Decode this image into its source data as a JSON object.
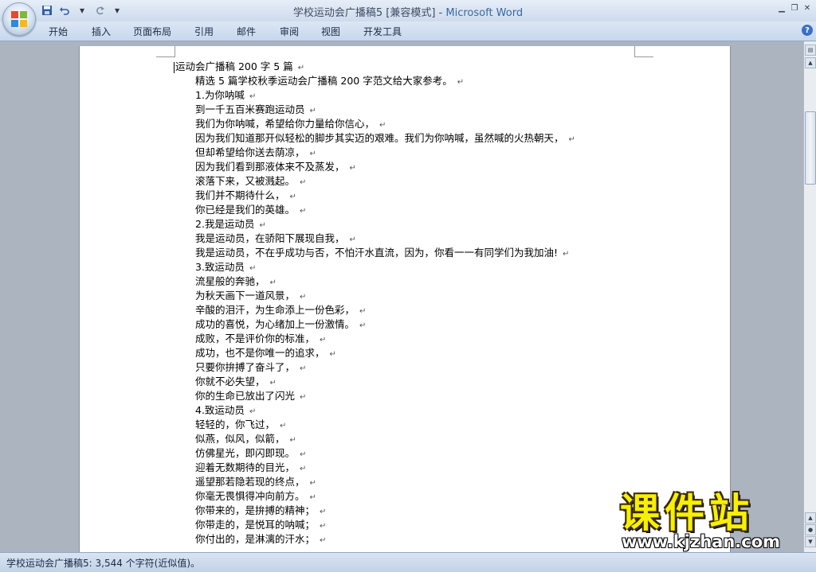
{
  "window": {
    "title": "学校运动会广播稿5 [兼容模式] - ",
    "app_name": "Microsoft Word"
  },
  "ribbon": {
    "tabs": [
      "开始",
      "插入",
      "页面布局",
      "引用",
      "邮件",
      "审阅",
      "视图",
      "开发工具"
    ]
  },
  "document": {
    "lines": [
      "运动会广播稿 200 字 5 篇",
      "精选 5 篇学校秋季运动会广播稿 200 字范文给大家参考。",
      "1.为你呐喊",
      "到一千五百米赛跑运动员",
      "我们为你呐喊，希望给你力量给你信心，",
      "因为我们知道那开似轻松的脚步其实迈的艰难。我们为你呐喊，虽然喊的火热朝天，",
      "但却希望给你送去荫凉，",
      "因为我们看到那液体来不及蒸发，",
      "滚落下来，又被溅起。",
      "我们并不期待什么，",
      "你已经是我们的英雄。",
      "2.我是运动员",
      "我是运动员，在骄阳下展现自我，",
      "我是运动员，不在乎成功与否，不怕汗水直流，因为，你看一一有同学们为我加油!",
      "3.致运动员",
      "流星般的奔驰，",
      "为秋天画下一道风景，",
      "辛酸的泪汗，为生命添上一份色彩，",
      "成功的喜悦，为心绪加上一份激情。",
      "成败，不是评价你的标准，",
      "成功，也不是你唯一的追求，",
      "只要你拚搏了奋斗了，",
      "你就不必失望，",
      "你的生命已放出了闪光",
      "4.致运动员",
      "轻轻的，你飞过，",
      "似燕，似风，似箭，",
      "仿佛星光，即闪即现。",
      "迎着无数期待的目光，",
      "遥望那若隐若现的终点，",
      "你毫无畏惧得冲向前方。",
      "你带来的，是拚搏的精神；",
      "你带走的，是悦耳的呐喊；",
      "你付出的，是淋漓的汗水；"
    ]
  },
  "status_bar": {
    "text": "学校运动会广播稿5: 3,544 个字符(近似值)。"
  },
  "watermark": {
    "text": "课件站",
    "url": "www.kjzhan.com"
  },
  "icons": {
    "save": "save-icon",
    "undo": "undo-icon",
    "redo": "redo-icon",
    "help": "help-icon",
    "paragraph_mark": "paragraph-mark-icon"
  },
  "colors": {
    "title_app": "#3a66a5",
    "watermark": "#f7f000"
  }
}
